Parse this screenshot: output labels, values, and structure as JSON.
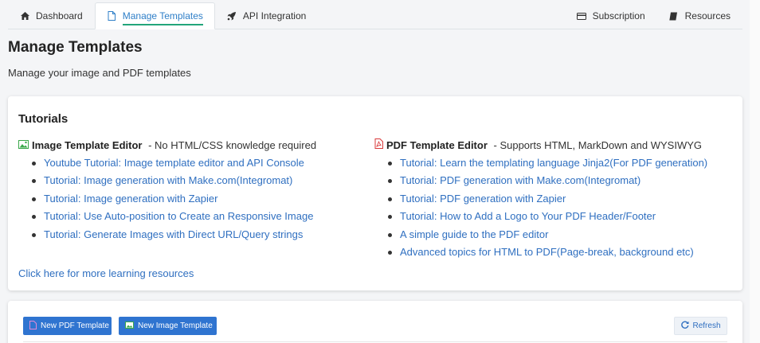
{
  "nav": {
    "tabs": [
      {
        "label": "Dashboard",
        "icon": "home-icon"
      },
      {
        "label": "Manage Templates",
        "icon": "file-icon"
      },
      {
        "label": "API Integration",
        "icon": "rocket-icon"
      }
    ],
    "right": [
      {
        "label": "Subscription",
        "icon": "credit-card-icon"
      },
      {
        "label": "Resources",
        "icon": "book-icon"
      }
    ]
  },
  "page": {
    "title": "Manage Templates",
    "subtitle": "Manage your image and PDF templates"
  },
  "tutorials": {
    "title": "Tutorials",
    "image": {
      "heading": "Image Template Editor",
      "tagline": " - No HTML/CSS knowledge required",
      "links": [
        "Youtube Tutorial: Image template editor and API Console",
        "Tutorial: Image generation with Make.com(Integromat)",
        "Tutorial: Image generation with Zapier",
        "Tutorial: Use Auto-position to Create an Responsive Image",
        "Tutorial: Generate Images with Direct URL/Query strings"
      ]
    },
    "pdf": {
      "heading": "PDF Template Editor",
      "tagline": " - Supports HTML, MarkDown and WYSIWYG",
      "links": [
        "Tutorial: Learn the templating language Jinja2(For PDF generation)",
        "Tutorial: PDF generation with Make.com(Integromat)",
        "Tutorial: PDF generation with Zapier",
        "Tutorial: How to Add a Logo to Your PDF Header/Footer",
        "A simple guide to the PDF editor",
        "Advanced topics for HTML to PDF(Page-break, background etc)"
      ]
    },
    "more": "Click here for more learning resources"
  },
  "toolbar": {
    "new_pdf": "New PDF Template",
    "new_image": "New Image Template",
    "refresh": "Refresh"
  },
  "colors": {
    "accent": "#2f74d0",
    "link": "#2f6fc0",
    "active_underline": "#22a57a",
    "image_icon": "#3aa84a",
    "pdf_icon": "#d9383a"
  }
}
